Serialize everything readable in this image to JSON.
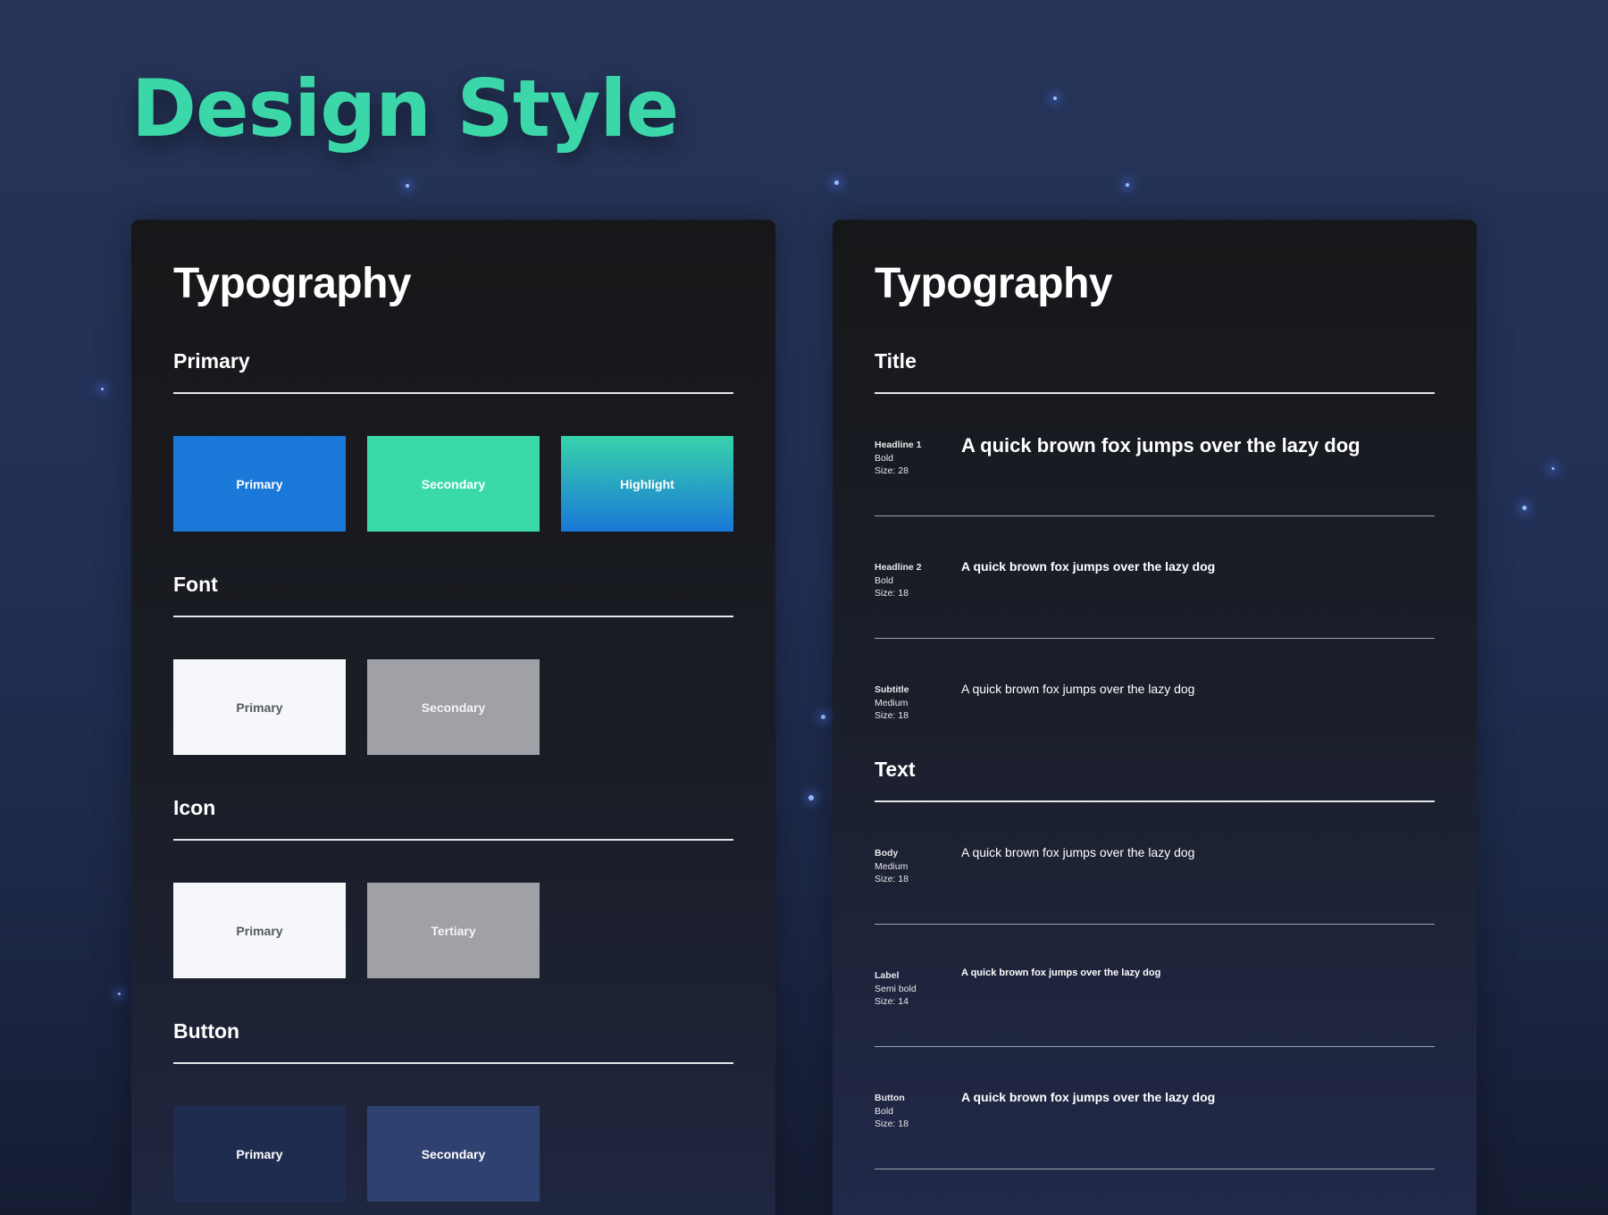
{
  "page_title": "Design Style",
  "colors": {
    "primary": "#1a78d8",
    "secondary": "#3adaa8",
    "highlight_from": "#37d3ab",
    "highlight_to": "#1a78d8",
    "font_primary": "#f5f7fa",
    "font_secondary": "#9fa1a6",
    "icon_primary": "#f5f7fa",
    "icon_tertiary": "#9fa1a6",
    "button_primary": "#1f2b4f",
    "button_secondary": "#2f4170"
  },
  "left_panel": {
    "title": "Typography",
    "groups": [
      {
        "heading": "Primary",
        "swatches": [
          "Primary",
          "Secondary",
          "Highlight"
        ]
      },
      {
        "heading": "Font",
        "swatches": [
          "Primary",
          "Secondary"
        ]
      },
      {
        "heading": "Icon",
        "swatches": [
          "Primary",
          "Tertiary"
        ]
      },
      {
        "heading": "Button",
        "swatches": [
          "Primary",
          "Secondary"
        ]
      }
    ]
  },
  "right_panel": {
    "title": "Typography",
    "sections": [
      {
        "heading": "Title",
        "rows": [
          {
            "name": "Headline 1",
            "weight": "Bold",
            "size": "Size: 28",
            "sample": "A quick brown fox jumps over the lazy dog"
          },
          {
            "name": "Headline 2",
            "weight": "Bold",
            "size": "Size: 18",
            "sample": "A quick brown fox jumps over the lazy dog"
          },
          {
            "name": "Subtitle",
            "weight": "Medium",
            "size": "Size: 18",
            "sample": "A quick brown fox jumps over the lazy dog"
          }
        ]
      },
      {
        "heading": "Text",
        "rows": [
          {
            "name": "Body",
            "weight": "Medium",
            "size": "Size: 18",
            "sample": "A quick brown fox jumps over the lazy dog"
          },
          {
            "name": "Label",
            "weight": "Semi bold",
            "size": "Size: 14",
            "sample": "A quick brown fox jumps over the lazy dog"
          },
          {
            "name": "Button",
            "weight": "Bold",
            "size": "Size: 18",
            "sample": "A quick brown fox jumps over the lazy dog"
          }
        ]
      }
    ]
  }
}
